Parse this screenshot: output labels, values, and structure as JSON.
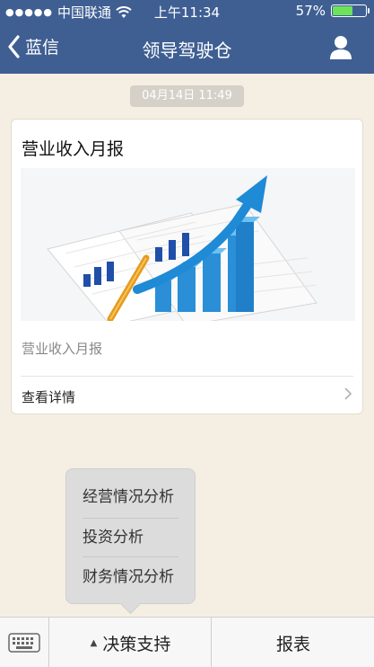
{
  "status_bar": {
    "carrier": "中国联通",
    "time": "上午11:34",
    "battery": "57%",
    "battery_level": 0.57,
    "icons": [
      "signal-dots-icon",
      "wifi-icon",
      "battery-icon"
    ]
  },
  "nav": {
    "back_label": "蓝信",
    "title": "领导驾驶仓",
    "icons": [
      "chevron-left-icon",
      "user-icon"
    ]
  },
  "message": {
    "timestamp": "04月14日 11:49",
    "card": {
      "title": "营业收入月报",
      "description": "营业收入月报",
      "detail_label": "查看详情",
      "image_icon": "growth-chart-illustration"
    }
  },
  "popup_menu": {
    "items": [
      {
        "label": "经营情况分析"
      },
      {
        "label": "投资分析"
      },
      {
        "label": "财务情况分析"
      }
    ]
  },
  "bottom_bar": {
    "keyboard_icon": "keyboard-icon",
    "decision_label": "决策支持",
    "report_label": "报表"
  },
  "colors": {
    "nav_bg": "#3f5f93",
    "page_bg": "#f5efe3",
    "accent_blue": "#2a8fd6"
  }
}
